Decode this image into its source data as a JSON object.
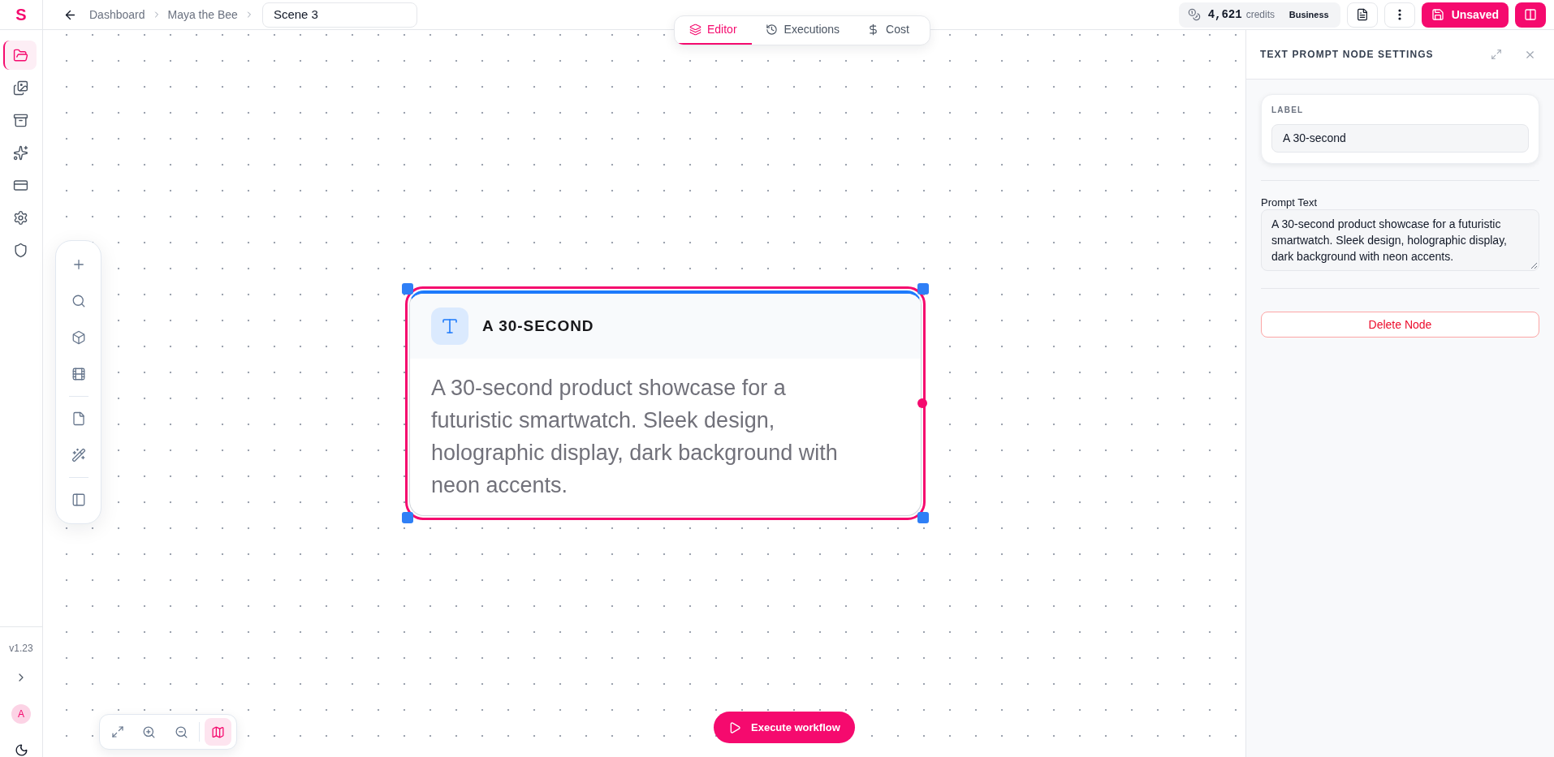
{
  "sidebar": {
    "logo": "S",
    "nav": [
      {
        "selected": true
      },
      {
        "selected": false
      },
      {
        "selected": false
      },
      {
        "selected": false
      },
      {
        "selected": false
      },
      {
        "selected": false
      },
      {
        "selected": false
      }
    ],
    "version": "v1.23",
    "avatar": "A"
  },
  "header": {
    "breadcrumbs": [
      "Dashboard",
      "Maya the Bee"
    ],
    "title_field": {
      "value": "Scene 3"
    },
    "view_tabs": [
      {
        "label": "Editor",
        "selected": true
      },
      {
        "label": "Executions",
        "selected": false
      },
      {
        "label": "Cost",
        "selected": false
      }
    ],
    "credits": {
      "amount": "4,621",
      "unit": "credits",
      "plan": "Business"
    },
    "save_button": {
      "label": "Unsaved"
    }
  },
  "canvas": {
    "node": {
      "title": "A 30-SECOND",
      "text": "A 30-second product showcase for a futuristic smartwatch. Sleek design, holographic display, dark background with neon accents.",
      "selected": true
    },
    "view_controls": {
      "minimap_on": true
    },
    "execute_button": {
      "label": "Execute workflow"
    }
  },
  "settings_panel": {
    "title": "TEXT PROMPT NODE SETTINGS",
    "label_field": {
      "label": "LABEL",
      "value": "A 30-second"
    },
    "prompt_field": {
      "label": "Prompt Text",
      "value": "A 30-second product showcase for a futuristic smartwatch. Sleek design, holographic display, dark background with neon accents."
    },
    "delete_button": {
      "label": "Delete Node"
    }
  }
}
